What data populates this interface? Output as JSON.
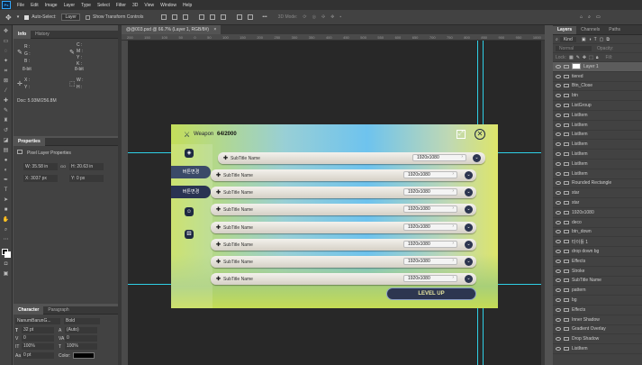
{
  "app": {
    "logo": "Ps"
  },
  "menu": [
    "File",
    "Edit",
    "Image",
    "Layer",
    "Type",
    "Select",
    "Filter",
    "3D",
    "View",
    "Window",
    "Help"
  ],
  "options": {
    "auto_select_label": "Auto-Select:",
    "auto_select_value": "Layer",
    "transform_label": "Show Transform Controls",
    "mode_label": "3D Mode:"
  },
  "tools": [
    "move-icon",
    "marquee-icon",
    "lasso-icon",
    "magic-wand-icon",
    "crop-icon",
    "frame-icon",
    "eyedropper-icon",
    "healing-icon",
    "brush-icon",
    "stamp-icon",
    "history-brush-icon",
    "eraser-icon",
    "gradient-icon",
    "blur-icon",
    "dodge-icon",
    "pen-icon",
    "type-icon",
    "path-select-icon",
    "shape-icon",
    "hand-icon",
    "zoom-icon"
  ],
  "info_panel": {
    "tabs": [
      "Info",
      "History"
    ],
    "r_label": "R :",
    "g_label": "G :",
    "b_label": "B :",
    "c_label": "C :",
    "m_label": "M :",
    "y_label": "Y :",
    "k_label": "K :",
    "bit_left": "8-bit",
    "bit_right": "8-bit",
    "x_label": "X :",
    "y2_label": "Y :",
    "w_label": "W :",
    "h_label": "H :",
    "doc": "Doc: 5.93M/256.8M"
  },
  "properties_panel": {
    "title": "Properties",
    "subtitle": "Pixel Layer Properties",
    "w": "W: 35.58 in",
    "h": "H: 20.63 in",
    "go": "GO",
    "x": "X: 3037 px",
    "y": "Y: 0 px"
  },
  "character_panel": {
    "tabs": [
      "Character",
      "Paragraph"
    ],
    "font": "NanumBarunG...",
    "weight": "Bold",
    "size": "32 pt",
    "leading": "(Auto)",
    "tracking": "0",
    "kerning": "0",
    "scale_v": "100%",
    "scale_h": "100%",
    "baseline": "0 pt",
    "color_label": "Color:"
  },
  "document": {
    "tab_title": "@@003.psd @ 66.7% (Layer 1, RGB/8#)",
    "close": "×"
  },
  "ruler_ticks": [
    "200",
    "150",
    "100",
    "50",
    "0",
    "50",
    "100",
    "150",
    "200",
    "250",
    "300",
    "350",
    "400",
    "450",
    "500",
    "550",
    "600",
    "650",
    "700",
    "750",
    "800",
    "850",
    "900",
    "950",
    "1000"
  ],
  "ui_mock": {
    "header_title": "Weapon",
    "header_count": "64/2000",
    "side_tabs": [
      "버튼변경",
      "버튼변경"
    ],
    "side_icons": [
      "warrior-icon",
      "dice-icon"
    ],
    "rows": [
      {
        "label": "SubTitle Name",
        "value": "1920x1080"
      },
      {
        "label": "SubTitle Name",
        "value": "1920x1080"
      },
      {
        "label": "SubTitle Name",
        "value": "1920x1080"
      },
      {
        "label": "SubTitle Name",
        "value": "1920x1080"
      },
      {
        "label": "SubTitle Name",
        "value": "1920x1080"
      },
      {
        "label": "SubTitle Name",
        "value": "1920x1080"
      },
      {
        "label": "SubTitle Name",
        "value": "1920x1080"
      },
      {
        "label": "SubTitle Name",
        "value": "1920x1080"
      }
    ],
    "button": "LEVEL UP"
  },
  "layers_panel": {
    "tabs": [
      "Layers",
      "Channels",
      "Paths"
    ],
    "kind": "Kind",
    "blend": "Normal",
    "opacity_label": "Opacity:",
    "lock_label": "Lock:",
    "fill_label": "Fill:",
    "layers": [
      {
        "name": "Layer 1",
        "sel": true
      },
      {
        "name": "tiered"
      },
      {
        "name": "Btn_Close"
      },
      {
        "name": "btn"
      },
      {
        "name": "ListGroup"
      },
      {
        "name": "ListItem"
      },
      {
        "name": "ListItem"
      },
      {
        "name": "ListItem"
      },
      {
        "name": "ListItem"
      },
      {
        "name": "ListItem"
      },
      {
        "name": "ListItem"
      },
      {
        "name": "ListItem"
      },
      {
        "name": "Rounded Rectangle"
      },
      {
        "name": "star"
      },
      {
        "name": "star"
      },
      {
        "name": "1920x1080"
      },
      {
        "name": "deco"
      },
      {
        "name": "btn_down"
      },
      {
        "name": "타이틀 1"
      },
      {
        "name": "drop down bg"
      },
      {
        "name": "Effects"
      },
      {
        "name": "Stroke"
      },
      {
        "name": "SubTitle Name"
      },
      {
        "name": "pattern"
      },
      {
        "name": "bg"
      },
      {
        "name": "Effects"
      },
      {
        "name": "Inner Shadow"
      },
      {
        "name": "Gradient Overlay"
      },
      {
        "name": "Drop Shadow"
      },
      {
        "name": "ListItem"
      }
    ]
  }
}
